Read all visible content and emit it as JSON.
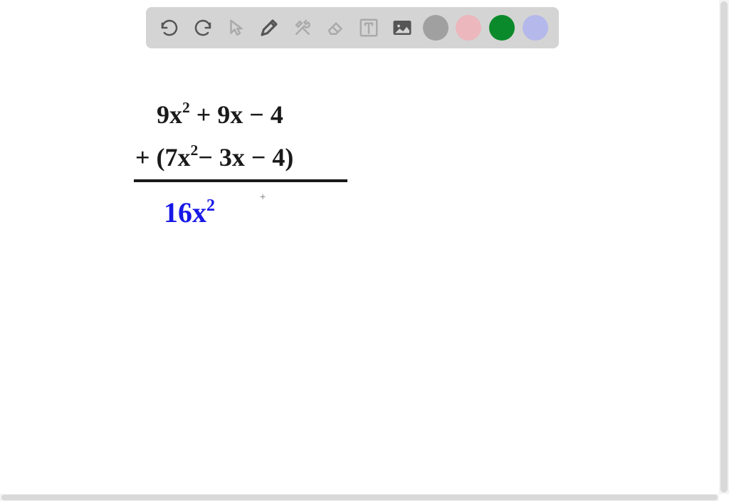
{
  "toolbar": {
    "undo_icon": "undo",
    "redo_icon": "redo",
    "pointer_icon": "pointer",
    "pencil_icon": "pencil",
    "tools_icon": "tools",
    "eraser_icon": "eraser",
    "text_icon": "text",
    "image_icon": "image",
    "colors": {
      "gray": "#a0a0a0",
      "pink": "#ecb7bd",
      "green": "#0a8a2a",
      "lavender": "#b4b8ea"
    }
  },
  "handwriting": {
    "line1_a": "9x",
    "line1_b": "2",
    "line1_c": " + 9x − 4",
    "line2_a": "+ (7x",
    "line2_b": "2",
    "line2_c": "− 3x − 4)",
    "line3_a": "16x",
    "line3_b": "2"
  },
  "cursor": "+"
}
